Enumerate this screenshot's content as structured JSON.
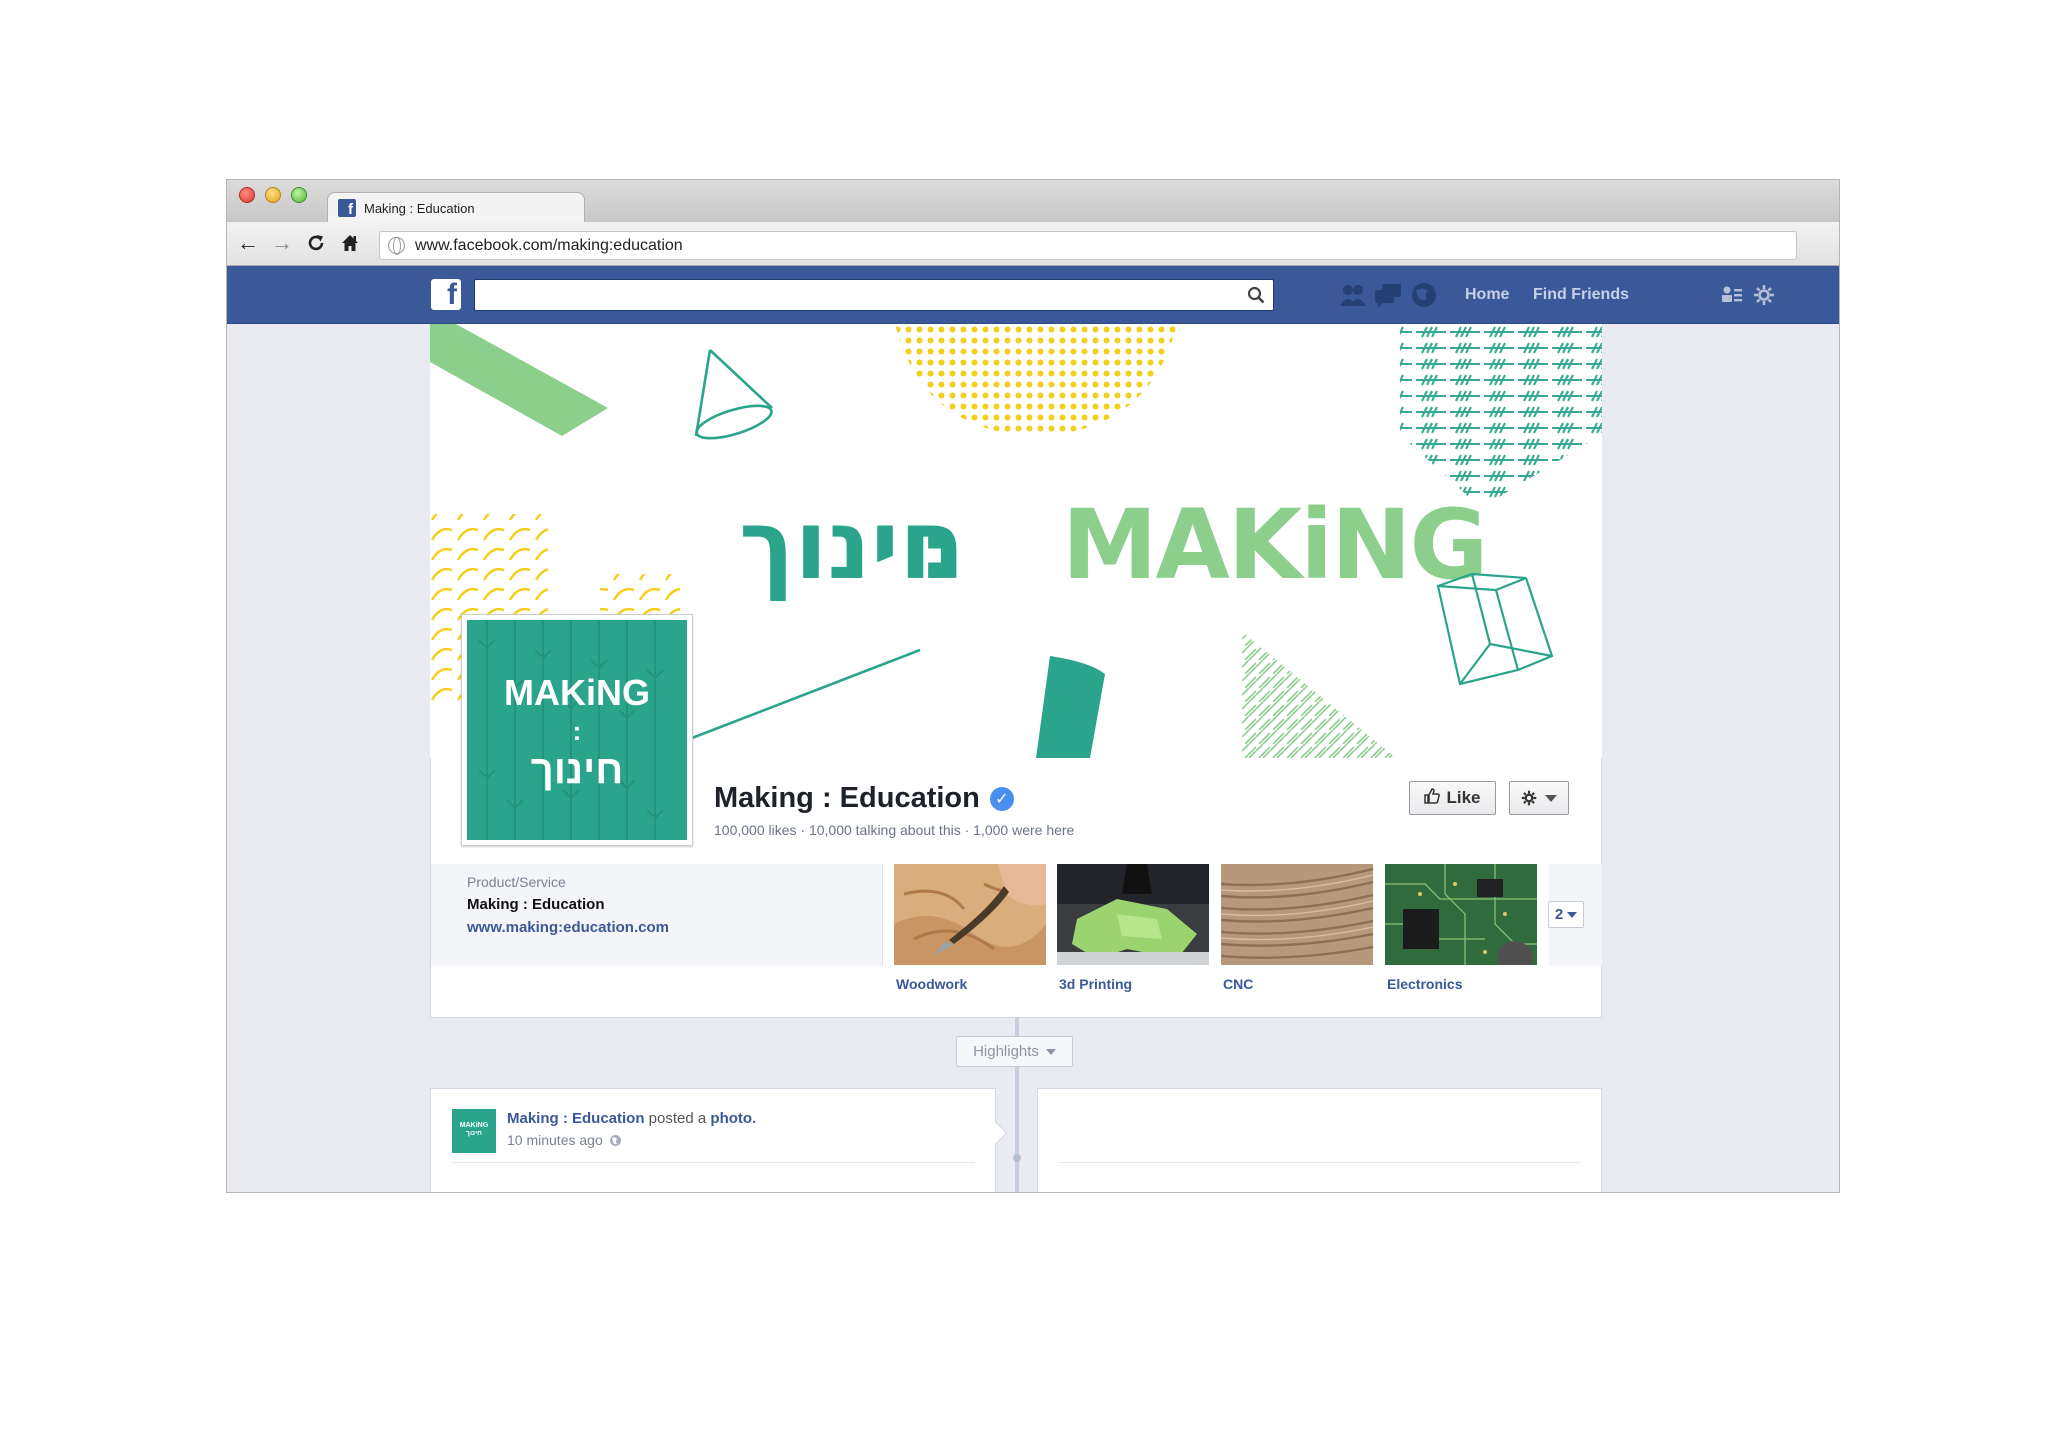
{
  "browser": {
    "tab_title": "Making : Education",
    "url": "www.facebook.com/making:education"
  },
  "fb_header": {
    "logo": "f",
    "search_placeholder": "",
    "nav": {
      "home": "Home",
      "find_friends": "Find Friends"
    },
    "icons": [
      "friend-requests-icon",
      "messages-icon",
      "notifications-icon",
      "privacy-shortcuts-icon",
      "settings-gear-icon"
    ]
  },
  "cover": {
    "latin_word": "MAKiNG",
    "separator": ":",
    "hebrew_word": "חינוך",
    "colors": {
      "teal": "#2aa58b",
      "green": "#8ccf8c",
      "yellow": "#f5cd1b"
    }
  },
  "profile_pic": {
    "line1": "MAKiNG",
    "line2": ":",
    "line3": "חינוך"
  },
  "page": {
    "name": "Making : Education",
    "stats": "100,000 likes · 10,000 talking about this · 1,000 were here",
    "like_label": "Like"
  },
  "about": {
    "category": "Product/Service",
    "name": "Making : Education",
    "url": "www.making:education.com"
  },
  "apps": [
    {
      "label": "Woodwork"
    },
    {
      "label": "3d Printing"
    },
    {
      "label": "CNC"
    },
    {
      "label": "Electronics"
    }
  ],
  "more_count": "2",
  "timeline": {
    "highlights_label": "Highlights"
  },
  "post": {
    "author": "Making : Education",
    "action": " posted a ",
    "object": "photo.",
    "time": "10 minutes ago",
    "avatar_line1": "MAKiNG",
    "avatar_line2": "חינוך"
  }
}
